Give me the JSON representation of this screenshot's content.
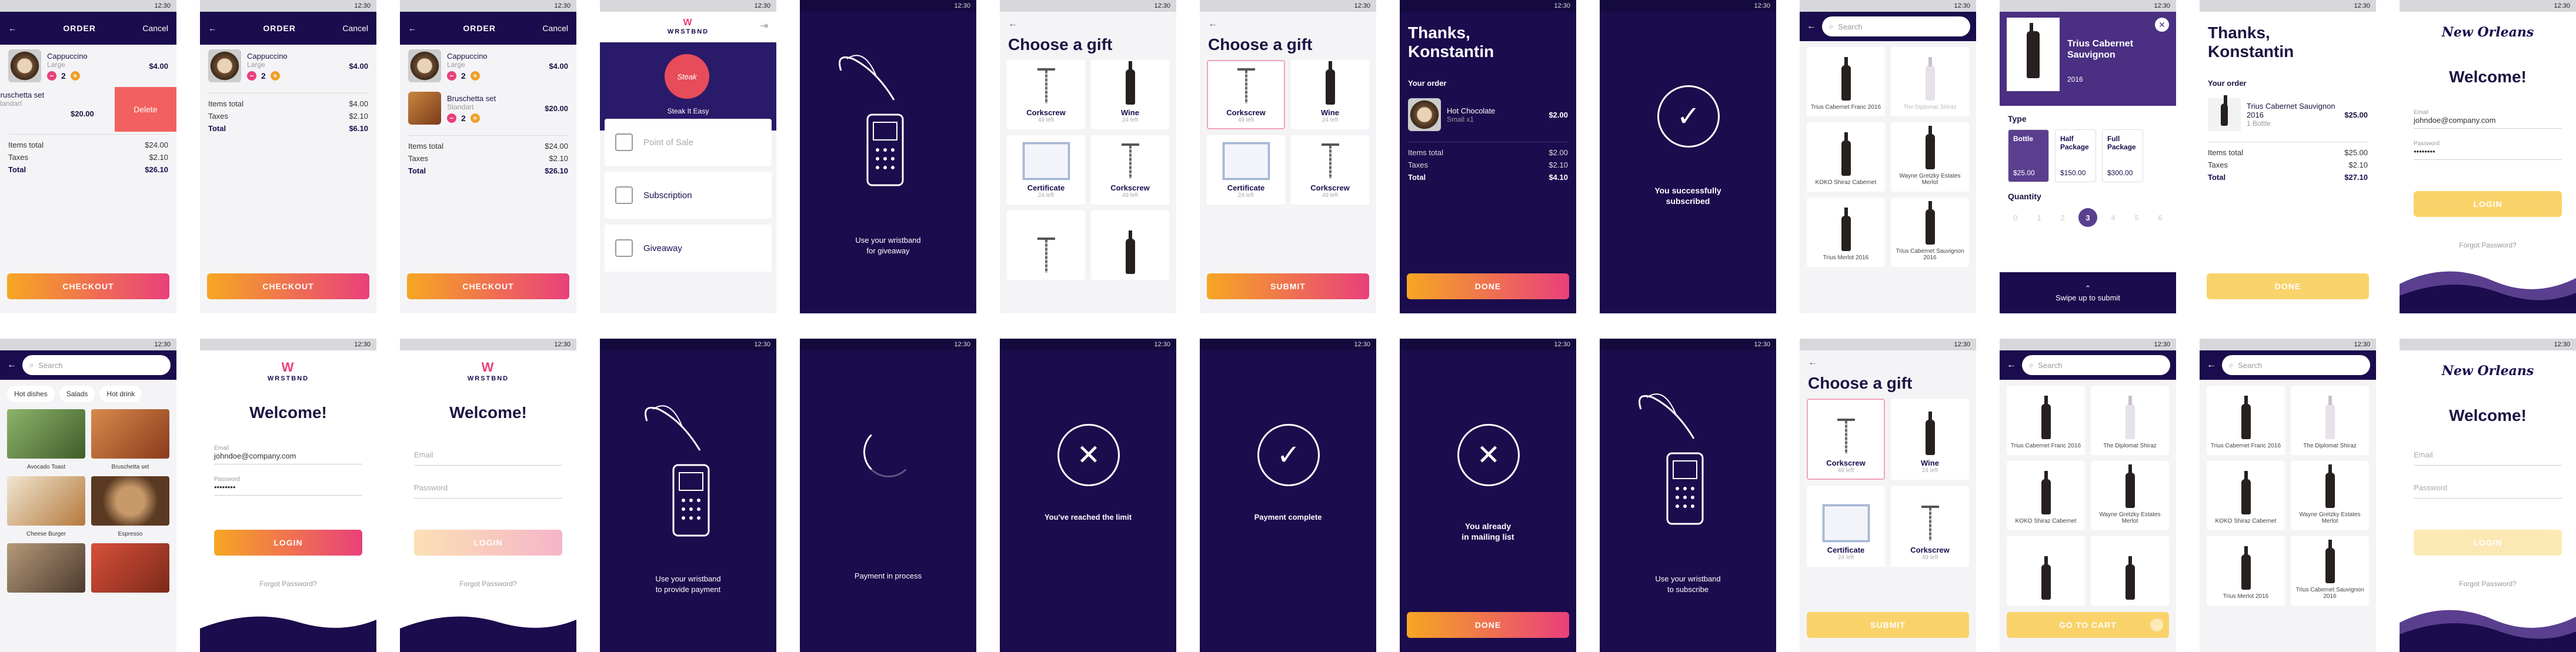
{
  "status": {
    "time": "12:30",
    "icons": "▾ ◢ ▮"
  },
  "cart": {
    "title": "ORDER",
    "cancel": "Cancel",
    "items": [
      {
        "name": "Cappuccino",
        "size": "Large",
        "qty": "2",
        "price": "$4.00"
      },
      {
        "name": "Bruschetta set",
        "size": "Standart",
        "qty": "2",
        "price": "$20.00"
      }
    ],
    "delete": "Delete",
    "items_total_label": "Items total",
    "items_total": "$24.00",
    "taxes_label": "Taxes",
    "taxes": "$2.10",
    "total_label": "Total",
    "total": "$26.10",
    "single_items_total": "$4.00",
    "single_taxes": "$2.10",
    "single_total": "$6.10",
    "checkout": "CHECKOUT"
  },
  "menu": {
    "brand": "WRSTBND",
    "tagline": "Steak It Easy",
    "items": [
      "Point of Sale",
      "Subscription",
      "Giveaway"
    ]
  },
  "wristband": {
    "giveaway": "Use your wristband\nfor giveaway",
    "payment": "Use your wristband\nto provide payment",
    "subscribe": "Use your wristband\nto subscribe"
  },
  "gift": {
    "title": "Choose a gift",
    "cards": [
      {
        "name": "Corkscrew",
        "left": "49 left"
      },
      {
        "name": "Wine",
        "left": "24 left"
      },
      {
        "name": "Certificate",
        "left": "24 left"
      },
      {
        "name": "Corkscrew",
        "left": "49 left"
      }
    ],
    "submit": "SUBMIT"
  },
  "thanks": {
    "title": "Thanks,\nKonstantin",
    "your_order": "Your order",
    "hot": {
      "name": "Hot Chocolate",
      "sub": "Small x1",
      "price": "$2.00",
      "items_total": "$2.00",
      "taxes": "$2.10",
      "total": "$4.10"
    },
    "wine": {
      "name": "Trius Cabernet Sauvignon 2016",
      "sub": "1 Bottle",
      "price": "$25.00",
      "items_total": "$25.00",
      "taxes": "$2.10",
      "total": "$27.10"
    },
    "done": "DONE"
  },
  "messages": {
    "subscribed": "You successfully\nsubscribed",
    "limit": "You've reached the limit",
    "payment_complete": "Payment complete",
    "in_process": "Payment in process",
    "mailing": "You already\nin mailing list"
  },
  "search": {
    "placeholder": "Search"
  },
  "wines": [
    "Trius Cabernet Franc 2016",
    "The Diplomat Shiraz",
    "KOKO Shiraz Cabernet",
    "Wayne Gretzky Estates Merlot",
    "Trius Merlot 2016",
    "Trius Cabernet Sauvignon 2016"
  ],
  "detail": {
    "name": "Trius Cabernet Sauvignon",
    "year": "2016",
    "type_label": "Type",
    "types": [
      {
        "name": "Bottle",
        "price": "$25.00"
      },
      {
        "name": "Half Package",
        "price": "$150.00"
      },
      {
        "name": "Full Package",
        "price": "$300.00"
      }
    ],
    "qty_label": "Quantity",
    "qty": [
      "0",
      "1",
      "2",
      "3",
      "4",
      "5",
      "6"
    ],
    "swipe": "Swipe up to submit"
  },
  "food": {
    "chips": [
      "Hot dishes",
      "Salads",
      "Hot drink"
    ],
    "items": [
      "Avocado Toast",
      "Bruschetta set",
      "Cheese Burger",
      "Espresso"
    ]
  },
  "login": {
    "welcome": "Welcome!",
    "email_label": "Email",
    "email": "johndoe@company.com",
    "password_label": "Password",
    "password": "••••••••",
    "login": "LOGIN",
    "forgot": "Forgot Password?",
    "city": "New Orleans"
  },
  "cart_btn": "GO TO CART",
  "colors": {
    "dark": "#1b0c4d",
    "orange": "#f6a623",
    "pink": "#e9407b",
    "yellow": "#f9d36a"
  }
}
